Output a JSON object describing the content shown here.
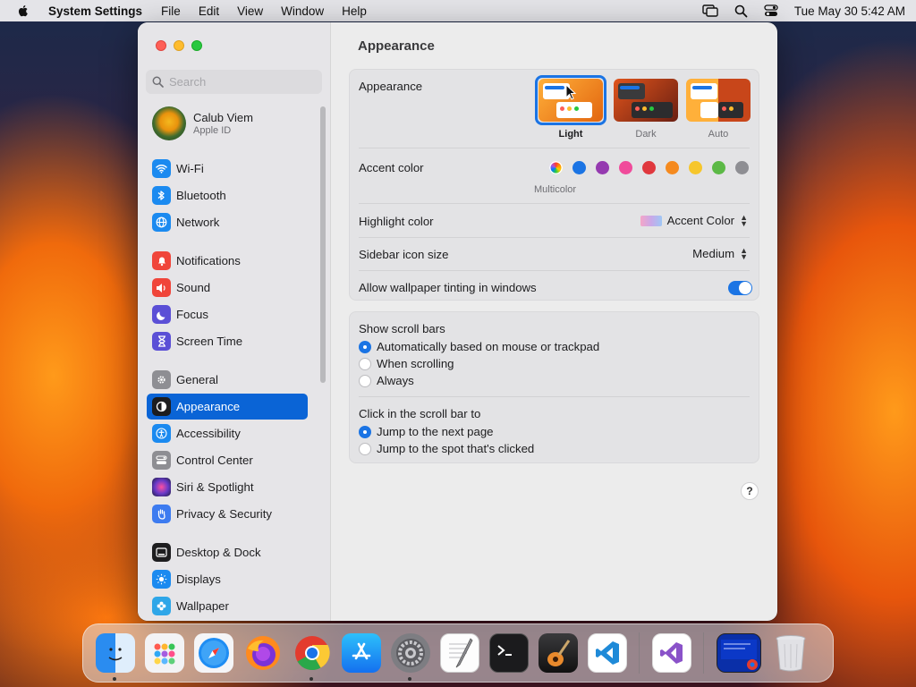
{
  "menubar": {
    "app_name": "System Settings",
    "menus": [
      "File",
      "Edit",
      "View",
      "Window",
      "Help"
    ],
    "datetime": "Tue May 30  5:42 AM"
  },
  "sidebar": {
    "search_placeholder": "Search",
    "profile": {
      "name": "Calub Viem",
      "subtitle": "Apple ID"
    },
    "items": [
      {
        "label": "Wi-Fi",
        "icon": "wifi-icon",
        "color": "#1b8af0"
      },
      {
        "label": "Bluetooth",
        "icon": "bluetooth-icon",
        "color": "#1b8af0"
      },
      {
        "label": "Network",
        "icon": "globe-icon",
        "color": "#1b8af0"
      },
      {
        "label": "Notifications",
        "icon": "bell-icon",
        "color": "#f0453a"
      },
      {
        "label": "Sound",
        "icon": "speaker-icon",
        "color": "#f0453a"
      },
      {
        "label": "Focus",
        "icon": "moon-icon",
        "color": "#5b4fd6"
      },
      {
        "label": "Screen Time",
        "icon": "hourglass-icon",
        "color": "#5b4fd6"
      },
      {
        "label": "General",
        "icon": "gear-icon",
        "color": "#8e8e93"
      },
      {
        "label": "Appearance",
        "icon": "appearance-icon",
        "color": "#1d1d1f",
        "active": true
      },
      {
        "label": "Accessibility",
        "icon": "accessibility-icon",
        "color": "#1b8af0"
      },
      {
        "label": "Control Center",
        "icon": "control-center-icon",
        "color": "#8e8e93"
      },
      {
        "label": "Siri & Spotlight",
        "icon": "siri-icon",
        "color": "#6a3ac9"
      },
      {
        "label": "Privacy & Security",
        "icon": "hand-icon",
        "color": "#3d7bf0"
      },
      {
        "label": "Desktop & Dock",
        "icon": "dock-icon",
        "color": "#1d1d1f"
      },
      {
        "label": "Displays",
        "icon": "sun-icon",
        "color": "#1b8af0"
      },
      {
        "label": "Wallpaper",
        "icon": "flower-icon",
        "color": "#2ea6e8"
      }
    ]
  },
  "main": {
    "title": "Appearance",
    "appearance_label": "Appearance",
    "themes": [
      {
        "label": "Light",
        "selected": true
      },
      {
        "label": "Dark",
        "selected": false
      },
      {
        "label": "Auto",
        "selected": false
      }
    ],
    "accent_label": "Accent color",
    "accent_colors": [
      "multicolor",
      "#1b74e4",
      "#953ab0",
      "#f04b9b",
      "#e0383e",
      "#f58a1f",
      "#f6c62c",
      "#5cb946",
      "#8e8e93"
    ],
    "accent_caption": "Multicolor",
    "highlight_label": "Highlight color",
    "highlight_value": "Accent Color",
    "sidebar_icon_label": "Sidebar icon size",
    "sidebar_icon_value": "Medium",
    "tinting_label": "Allow wallpaper tinting in windows",
    "tinting_on": true,
    "scrollbars_label": "Show scroll bars",
    "scrollbar_options": [
      {
        "label": "Automatically based on mouse or trackpad",
        "selected": true
      },
      {
        "label": "When scrolling",
        "selected": false
      },
      {
        "label": "Always",
        "selected": false
      }
    ],
    "click_label": "Click in the scroll bar to",
    "click_options": [
      {
        "label": "Jump to the next page",
        "selected": true
      },
      {
        "label": "Jump to the spot that's clicked",
        "selected": false
      }
    ],
    "help": "?"
  },
  "dock": {
    "apps": [
      "finder-icon",
      "launchpad-icon",
      "safari-icon",
      "firefox-icon",
      "chrome-icon",
      "app-store-icon",
      "system-settings-icon",
      "textedit-icon",
      "terminal-icon",
      "garageband-icon",
      "vscode-icon",
      "visual-studio-icon",
      "chrome-window-icon",
      "trash-icon"
    ]
  }
}
